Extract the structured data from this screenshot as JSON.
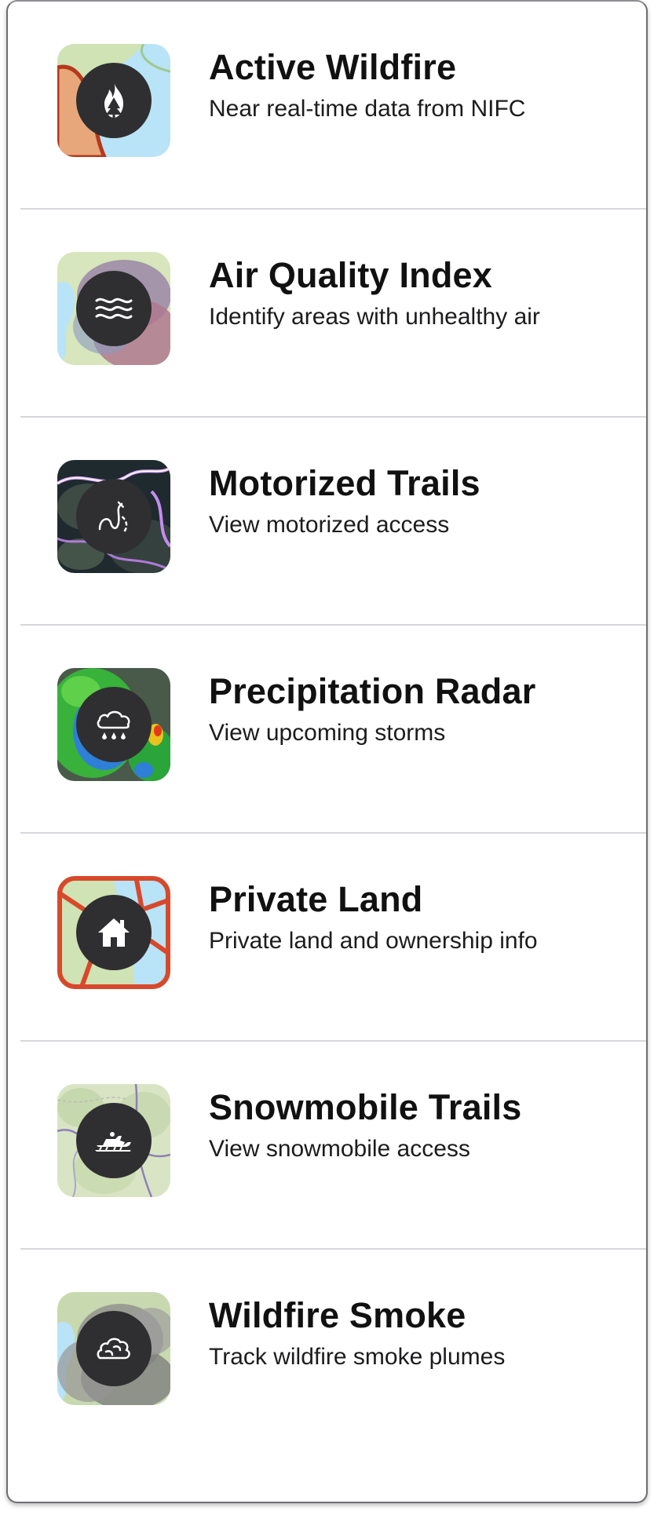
{
  "layers": [
    {
      "title": "Active Wildfire",
      "subtitle": "Near real-time data from NIFC",
      "icon": "fire-tree-icon"
    },
    {
      "title": "Air Quality Index",
      "subtitle": "Identify areas with unhealthy air",
      "icon": "wind-waves-icon"
    },
    {
      "title": "Motorized Trails",
      "subtitle": "View motorized access",
      "icon": "trail-path-icon"
    },
    {
      "title": "Precipitation Radar",
      "subtitle": "View upcoming storms",
      "icon": "rain-cloud-icon"
    },
    {
      "title": "Private Land",
      "subtitle": "Private land and ownership info",
      "icon": "house-icon"
    },
    {
      "title": "Snowmobile Trails",
      "subtitle": "View snowmobile access",
      "icon": "snowmobile-icon"
    },
    {
      "title": "Wildfire Smoke",
      "subtitle": "Track wildfire smoke plumes",
      "icon": "smoke-icon"
    }
  ]
}
